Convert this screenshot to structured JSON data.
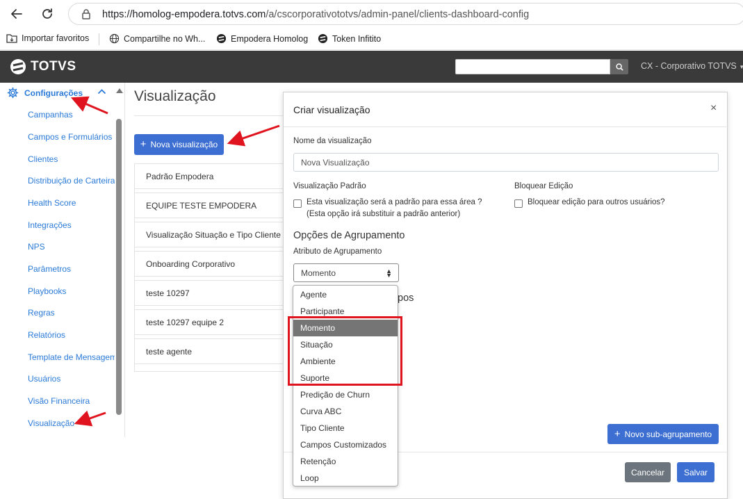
{
  "browser": {
    "url_host": "https://homolog-empodera.totvs.com",
    "url_path": "/a/cscorporativototvs/admin-panel/clients-dashboard-config",
    "bookmarks": [
      {
        "label": "Importar favoritos",
        "icon": "import-bookmarks-icon"
      },
      {
        "label": "Compartilhe no Wh...",
        "icon": "globe-icon"
      },
      {
        "label": "Empodera Homolog",
        "icon": "totvs-logo-icon"
      },
      {
        "label": "Token Infitito",
        "icon": "totvs-logo-icon"
      }
    ]
  },
  "header": {
    "brand": "TOTVS",
    "search_placeholder": "",
    "company": "CX - Corporativo TOTVS"
  },
  "sidebar": {
    "section": "Configurações",
    "items": [
      "Campanhas",
      "Campos e Formulários",
      "Clientes",
      "Distribuição de Carteira",
      "Health Score",
      "Integrações",
      "NPS",
      "Parâmetros",
      "Playbooks",
      "Regras",
      "Relatórios",
      "Template de Mensagem",
      "Usuários",
      "Visão Financeira",
      "Visualização"
    ]
  },
  "main": {
    "title": "Visualização",
    "new_button": "Nova visualização",
    "views": [
      "Padrão Empodera",
      "EQUIPE TESTE EMPODERA",
      "Visualização Situação e Tipo Cliente",
      "Onboarding Corporativo",
      "teste 10297",
      "teste 10297 equipe 2",
      "teste agente"
    ]
  },
  "modal": {
    "title": "Criar visualização",
    "close": "×",
    "name_label": "Nome da visualização",
    "name_value": "Nova Visualização",
    "default_label": "Visualização Padrão",
    "default_checkbox": "Esta visualização será a padrão para essa área ?",
    "default_hint": "(Esta opção irá substituir a padrão anterior)",
    "lock_label": "Bloquear Edição",
    "lock_checkbox": "Bloquear edição para outros usuários?",
    "grouping_section": "Opções de Agrupamento",
    "grouping_attr_label": "Atributo de Agrupamento",
    "grouping_selected": "Momento",
    "partial_text": "pos",
    "sub_group_button": "Novo sub-agrupamento",
    "cancel_button": "Cancelar",
    "save_button": "Salvar",
    "grouping_options": [
      "Agente",
      "Participante",
      "Momento",
      "Situação",
      "Ambiente",
      "Suporte",
      "Predição de Churn",
      "Curva ABC",
      "Tipo Cliente",
      "Campos Customizados",
      "Retenção",
      "Loop"
    ]
  },
  "colors": {
    "accent": "#3c6fd1",
    "link": "#2a7ad8",
    "header_bg": "#3a3a3a",
    "annotation": "#e0141e"
  }
}
